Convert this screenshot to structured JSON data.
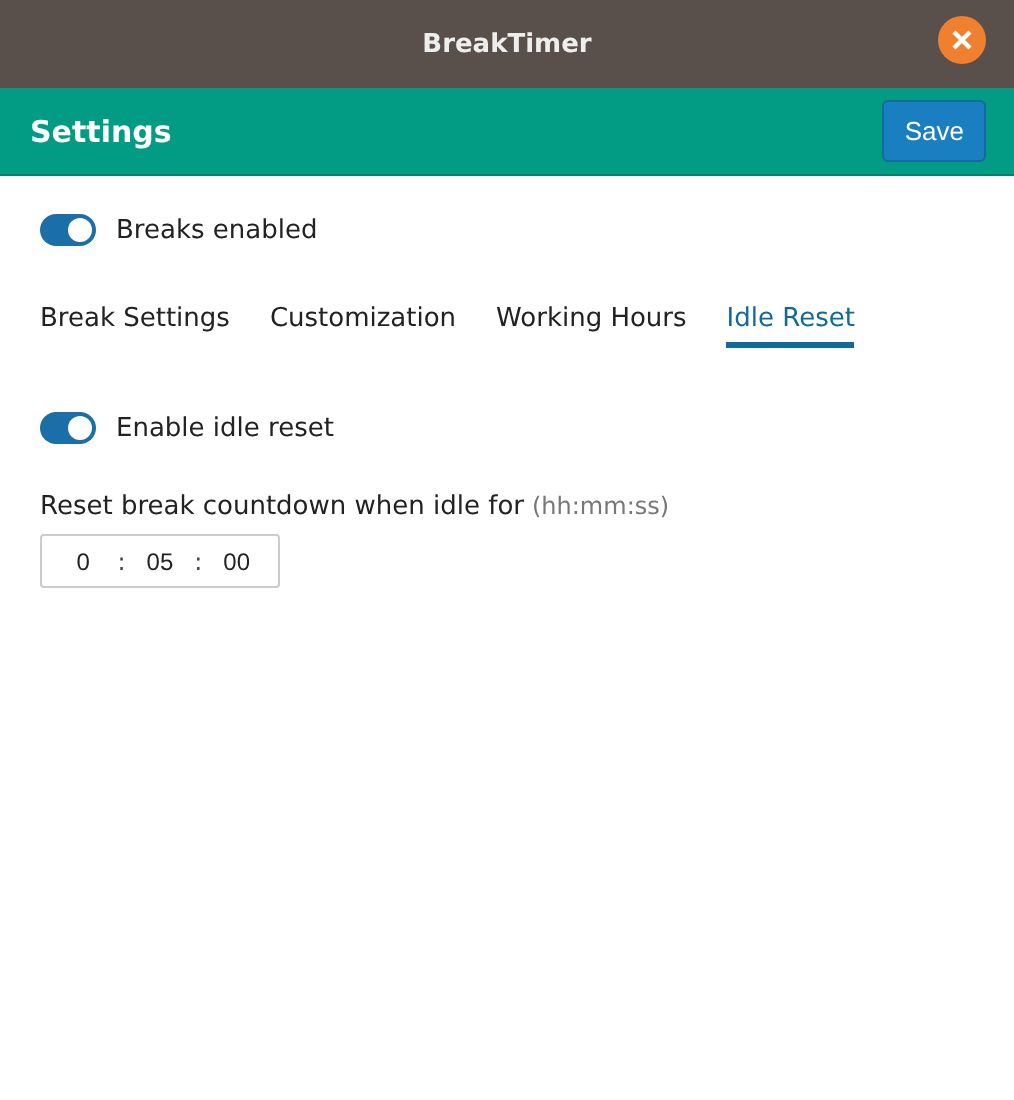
{
  "window": {
    "title": "BreakTimer"
  },
  "header": {
    "title": "Settings",
    "save_button": "Save"
  },
  "breaks_enabled": {
    "label": "Breaks enabled",
    "on": true
  },
  "tabs": [
    {
      "label": "Break Settings",
      "selected": false
    },
    {
      "label": "Customization",
      "selected": false
    },
    {
      "label": "Working Hours",
      "selected": false
    },
    {
      "label": "Idle Reset",
      "selected": true
    }
  ],
  "idle_reset": {
    "label": "Enable idle reset",
    "on": true
  },
  "idle_time": {
    "label": "Reset break countdown when idle for",
    "hint": "(hh:mm:ss)",
    "parts": [
      "0",
      "05",
      "00"
    ],
    "separators": [
      ":",
      ":"
    ]
  }
}
